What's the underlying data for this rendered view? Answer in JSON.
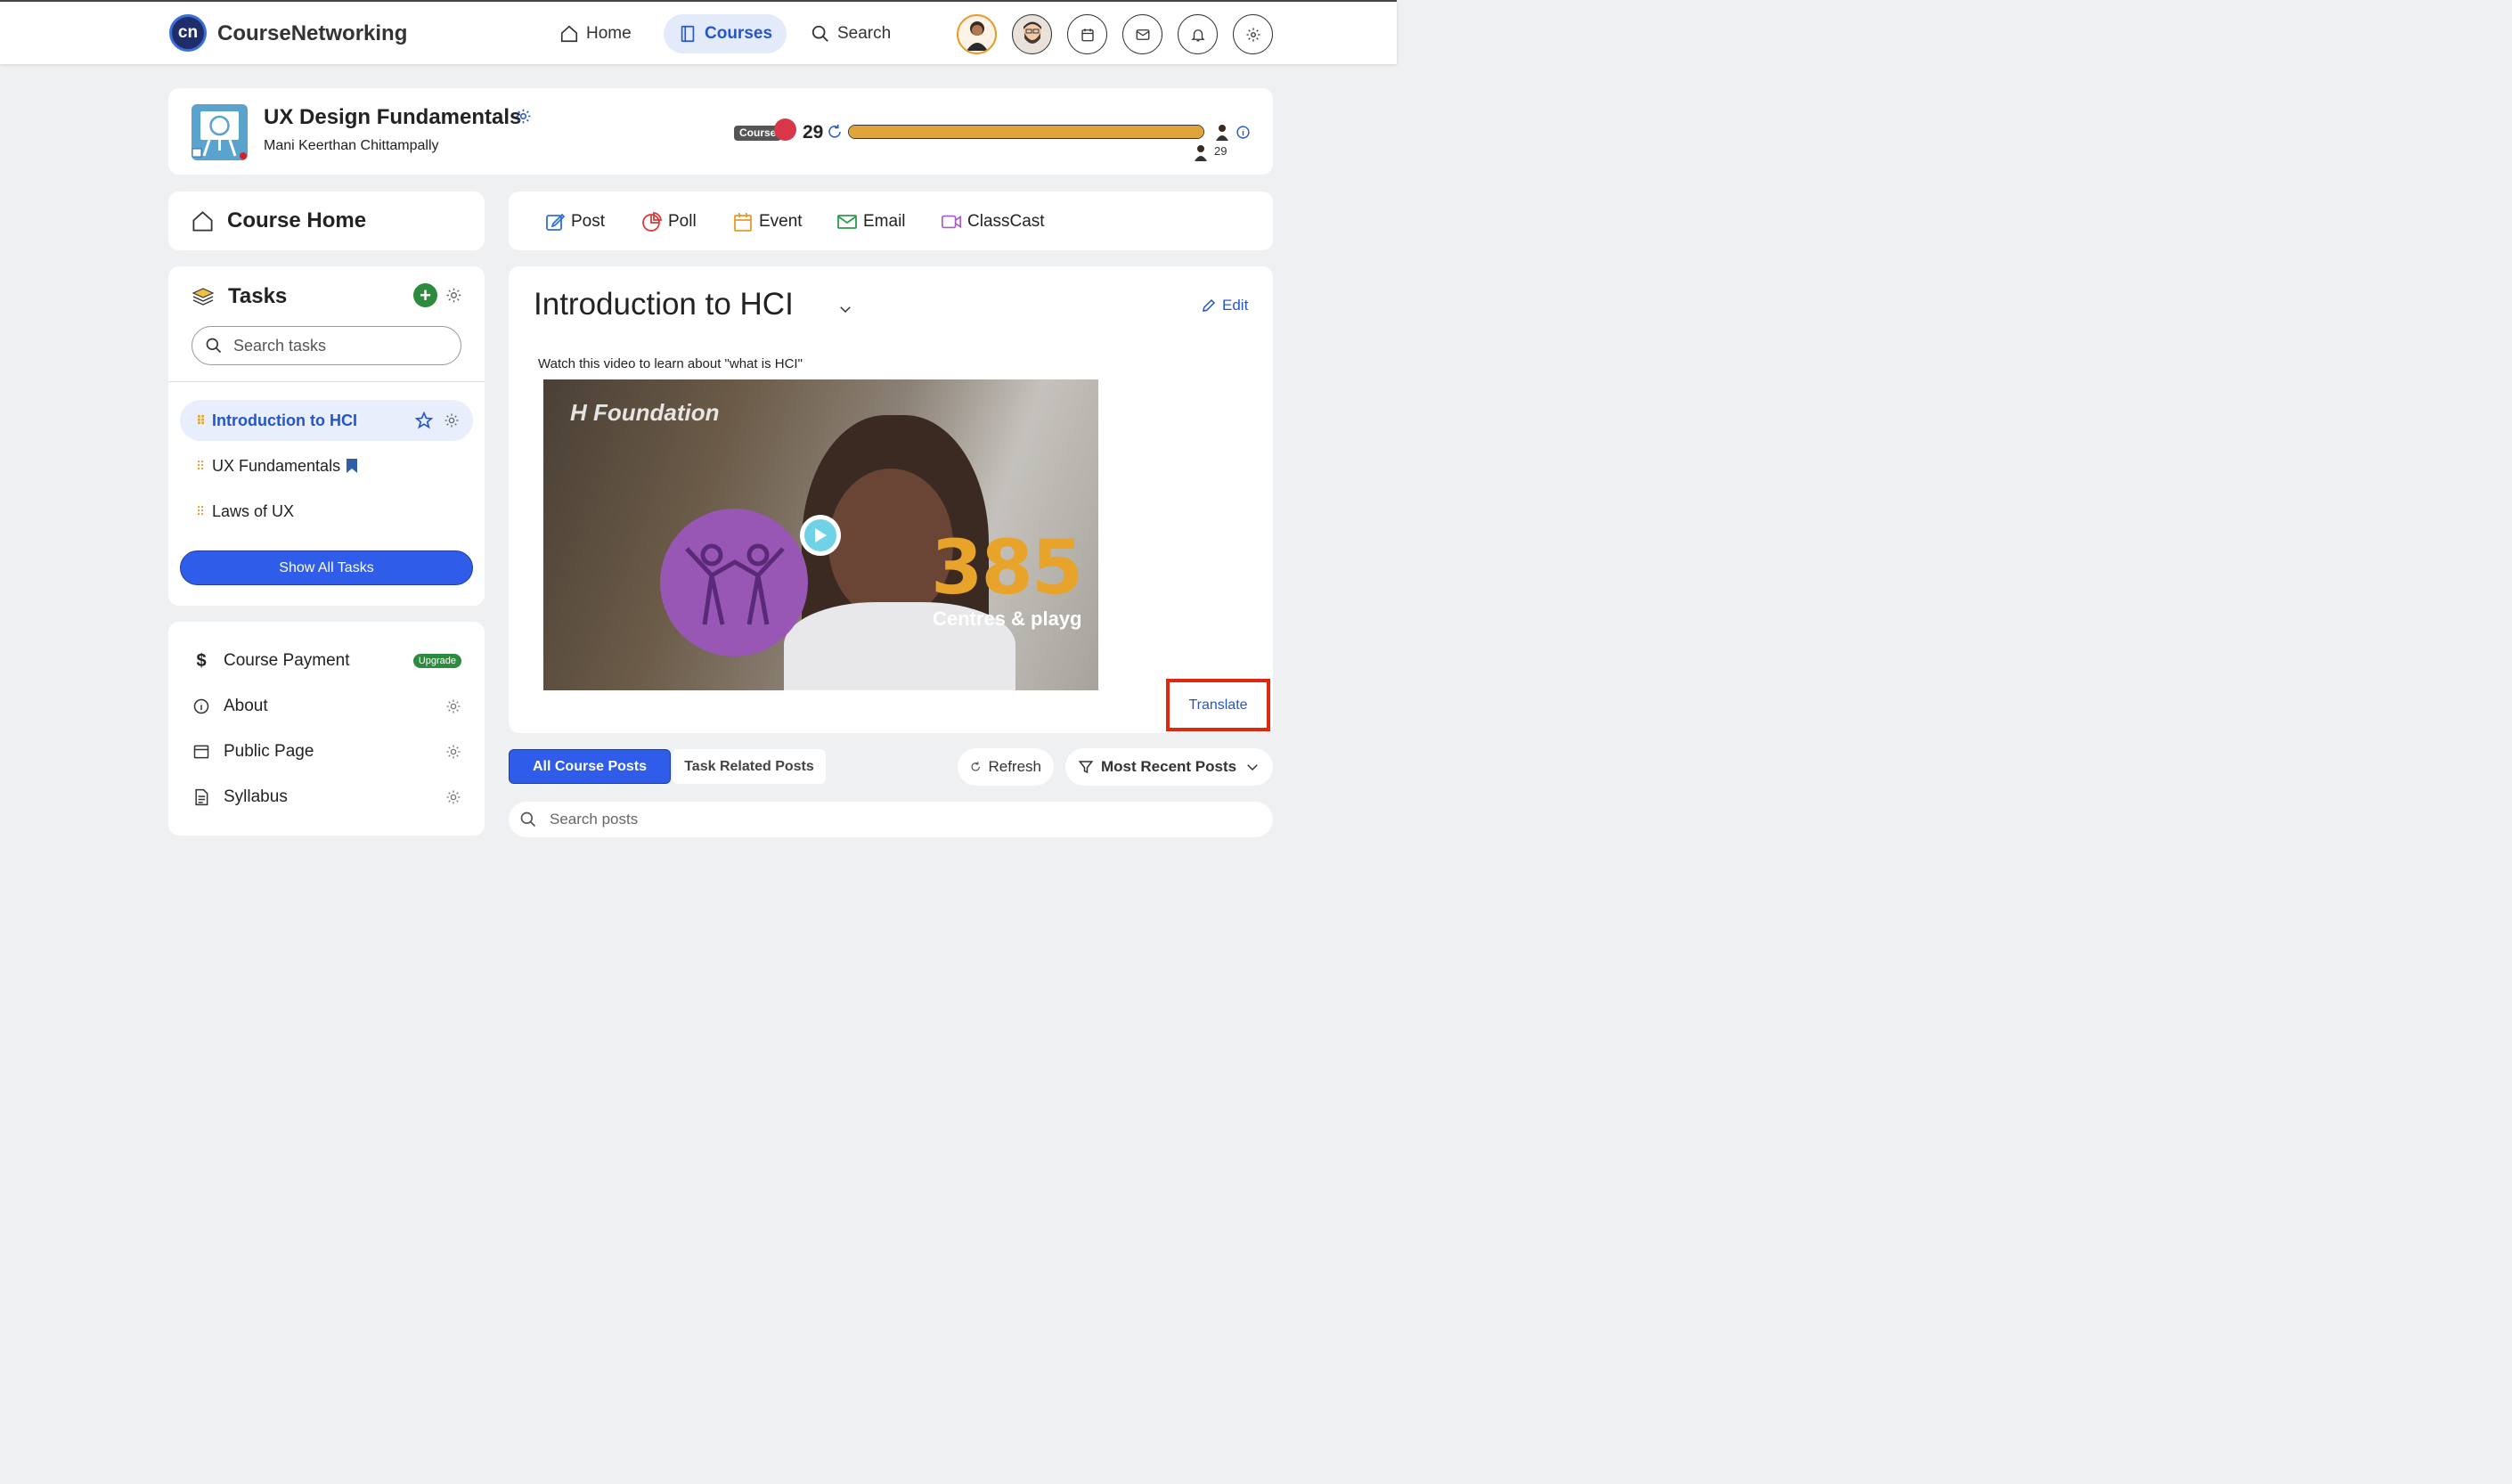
{
  "topbar": {
    "logo_text": "cn",
    "brand": "CourseNetworking",
    "nav": {
      "home": "Home",
      "courses": "Courses",
      "search": "Search"
    }
  },
  "course": {
    "title": "UX Design Fundamentals",
    "author": "Mani Keerthan Chittampally",
    "badge": "Course",
    "score": "29",
    "progress_fraction": 1.0,
    "leader_score": "29"
  },
  "sidebar": {
    "course_home": "Course Home",
    "tasks_title": "Tasks",
    "search_placeholder": "Search tasks",
    "tasks": [
      {
        "label": "Introduction to HCI",
        "active": true
      },
      {
        "label": "UX Fundamentals",
        "active": false
      },
      {
        "label": "Laws of UX",
        "active": false
      }
    ],
    "show_all": "Show All Tasks",
    "menu": [
      {
        "label": "Course Payment",
        "icon": "$",
        "badge": "Upgrade"
      },
      {
        "label": "About"
      },
      {
        "label": "Public Page"
      },
      {
        "label": "Syllabus"
      }
    ]
  },
  "actions": {
    "post": "Post",
    "poll": "Poll",
    "event": "Event",
    "email": "Email",
    "classcast": "ClassCast"
  },
  "task_detail": {
    "title": "Introduction to HCI",
    "edit": "Edit",
    "description": "Watch this video to learn about \"what is HCI\"",
    "video": {
      "brand": "H  Foundation",
      "number": "385",
      "caption": "Centres & playg"
    },
    "translate": "Translate"
  },
  "posts": {
    "tab_all": "All Course Posts",
    "tab_task": "Task Related Posts",
    "refresh": "Refresh",
    "sort": "Most Recent Posts",
    "search_placeholder": "Search posts"
  },
  "colors": {
    "accent": "#2456c9",
    "primary_button": "#2f5ce8",
    "progress": "#e0a43a",
    "highlight_box": "#e02810",
    "upgrade": "#2e8b3e"
  }
}
